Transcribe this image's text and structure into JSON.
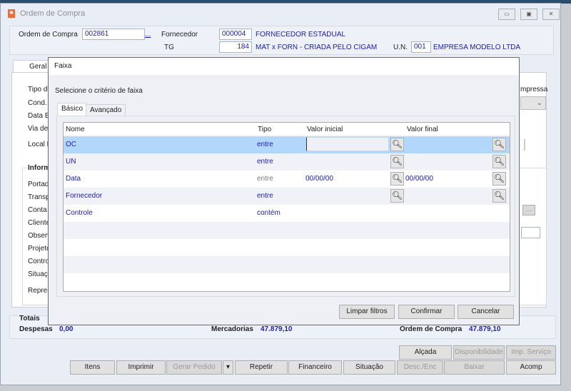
{
  "window": {
    "title": "Ordem de Compra",
    "minimize": "▭",
    "maximize": "▣",
    "close": "✕"
  },
  "header": {
    "oc_label": "Ordem de Compra",
    "oc_value": "002861",
    "oc_lookup": "...",
    "fornecedor_label": "Fornecedor",
    "fornecedor_code": "000004",
    "fornecedor_name": "FORNECEDOR ESTADUAL",
    "tg_label": "TG",
    "tg_value": "184",
    "tg_name": "MAT x FORN - CRIADA PELO CIGAM",
    "un_label": "U.N.",
    "un_value": "001",
    "un_name": "EMPRESA MODELO LTDA"
  },
  "main": {
    "tab": "Geral",
    "labels": [
      "Tipo de",
      "Cond.",
      "Data E",
      "Via de",
      "Local E"
    ],
    "group_title": "Inform",
    "group_labels": [
      "Portad",
      "Transp",
      "Conta",
      "Cliente",
      "Observ",
      "Projeto",
      "Contro",
      "Situaç",
      "Repres"
    ],
    "right_label": "mpressa",
    "lookup": "..."
  },
  "totais": {
    "title": "Totais",
    "despesas_label": "Despesas",
    "despesas_value": "0,00",
    "mercadorias_label": "Mercadorias",
    "mercadorias_value": "47.879,10",
    "oc_label": "Ordem de Compra",
    "oc_value": "47.879,10"
  },
  "buttons": {
    "alcada": "Alçada",
    "disponibilidade": "Disponibilidade",
    "imp_servico": "Imp. Serviço",
    "itens": "Itens",
    "imprimir": "Imprimir",
    "gerar_pedido": "Gerar Pedido",
    "dropdown": "▾",
    "repetir": "Repetir",
    "financeiro": "Financeiro",
    "situacao": "Situação",
    "desc_enc": "Desc./Enc",
    "baixar": "Baixar",
    "acomp": "Acomp"
  },
  "dialog": {
    "title": "Faixa",
    "prompt": "Selecione o critério de faixa",
    "tabs": [
      "Básico",
      "Avançado"
    ],
    "columns": [
      "Nome",
      "Tipo",
      "Valor inicial",
      "Valor final"
    ],
    "rows": [
      {
        "nome": "OC",
        "tipo": "entre",
        "inicial": "",
        "final": ""
      },
      {
        "nome": "UN",
        "tipo": "entre",
        "inicial": "",
        "final": ""
      },
      {
        "nome": "Data",
        "tipo": "entre",
        "inicial": "00/00/00",
        "final": "00/00/00"
      },
      {
        "nome": "Fornecedor",
        "tipo": "entre",
        "inicial": "",
        "final": ""
      },
      {
        "nome": "Controle",
        "tipo": "contém",
        "inicial": "",
        "final": ""
      }
    ],
    "limpar": "Limpar filtros",
    "confirmar": "Confirmar",
    "cancelar": "Cancelar"
  }
}
